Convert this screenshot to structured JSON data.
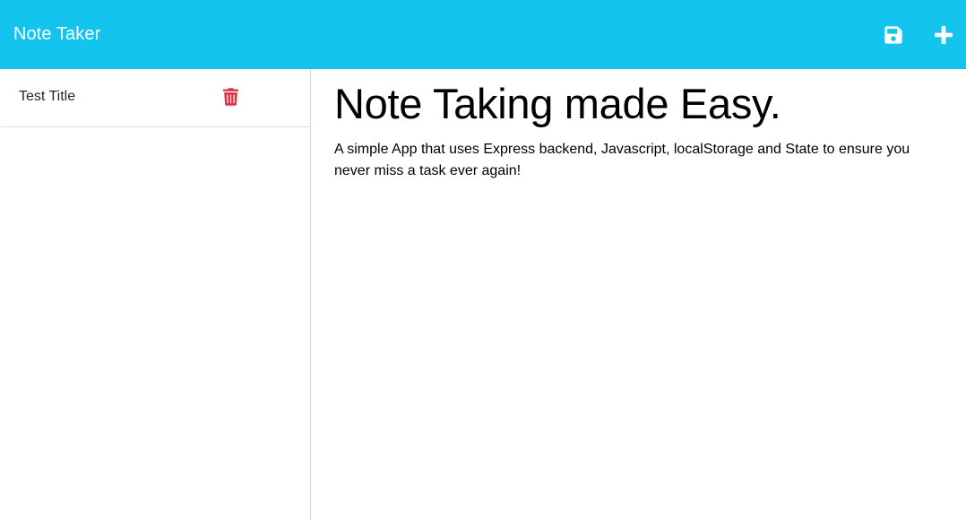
{
  "header": {
    "brand": "Note Taker",
    "icons": [
      "save-icon",
      "plus-icon"
    ]
  },
  "sidebar": {
    "notes": [
      {
        "title": "Test Title",
        "icon": "trash-icon"
      }
    ]
  },
  "main": {
    "title": "Note Taking made Easy.",
    "text": "A simple App that uses Express backend, Javascript, localStorage and State to ensure you never miss a task ever again!"
  },
  "colors": {
    "navbar": "#13c4ee",
    "delete": "#dc3545",
    "white": "#ffffff"
  }
}
